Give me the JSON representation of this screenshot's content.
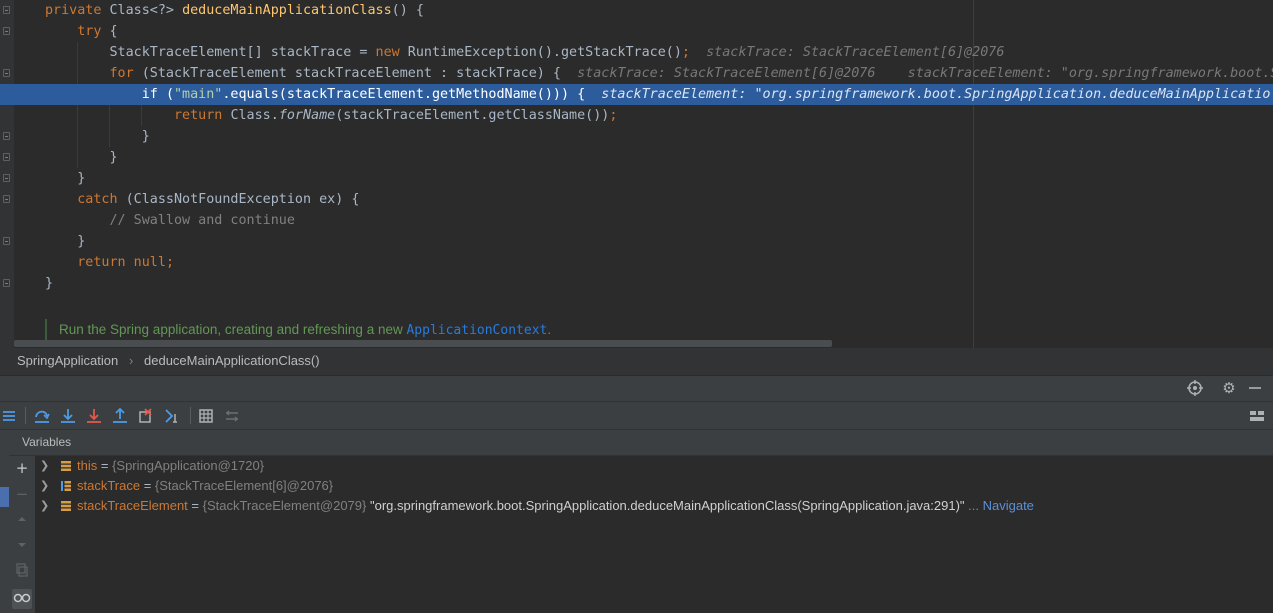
{
  "editor": {
    "lines": [
      [
        {
          "t": "private ",
          "c": "kw"
        },
        {
          "t": "Class<?> ",
          "c": ""
        },
        {
          "t": "deduceMainApplicationClass",
          "c": "fn"
        },
        {
          "t": "() {",
          "c": ""
        }
      ],
      [
        {
          "t": "    try ",
          "c": "kw"
        },
        {
          "t": "{",
          "c": ""
        }
      ],
      [
        {
          "t": "        StackTraceElement[] stackTrace = ",
          "c": ""
        },
        {
          "t": "new ",
          "c": "kw"
        },
        {
          "t": "RuntimeException().getStackTrace()",
          "c": ""
        },
        {
          "t": ";",
          "c": "kw"
        },
        {
          "t": "  stackTrace: StackTraceElement[6]@2076",
          "c": "hint"
        }
      ],
      [
        {
          "t": "        for ",
          "c": "kw"
        },
        {
          "t": "(StackTraceElement stackTraceElement : stackTrace) {",
          "c": ""
        },
        {
          "t": "  stackTrace: StackTraceElement[6]@2076    stackTraceElement: \"org.springframework.boot.S",
          "c": "hint"
        }
      ],
      [
        {
          "t": "            if ",
          "c": ""
        },
        {
          "t": "(",
          "c": ""
        },
        {
          "t": "\"main\"",
          "c": "str"
        },
        {
          "t": ".equals(stackTraceElement.getMethodName())) {",
          "c": ""
        },
        {
          "t": "  stackTraceElement: \"org.springframework.boot.SpringApplication.deduceMainApplicatio",
          "c": "hint"
        }
      ],
      [
        {
          "t": "                return ",
          "c": "kw"
        },
        {
          "t": "Class.",
          "c": ""
        },
        {
          "t": "forName",
          "c": "it"
        },
        {
          "t": "(stackTraceElement.getClassName())",
          "c": ""
        },
        {
          "t": ";",
          "c": "kw"
        }
      ],
      [
        {
          "t": "            }",
          "c": ""
        }
      ],
      [
        {
          "t": "        }",
          "c": ""
        }
      ],
      [
        {
          "t": "    }",
          "c": ""
        }
      ],
      [
        {
          "t": "    catch ",
          "c": "kw"
        },
        {
          "t": "(ClassNotFoundException ex) {",
          "c": ""
        }
      ],
      [
        {
          "t": "        // Swallow and continue",
          "c": "cmt"
        }
      ],
      [
        {
          "t": "    }",
          "c": ""
        }
      ],
      [
        {
          "t": "    return null",
          "c": "kw"
        },
        {
          "t": ";",
          "c": "kw"
        }
      ],
      [
        {
          "t": "}",
          "c": ""
        }
      ]
    ],
    "exec_line_index": 4,
    "doc_comment": {
      "text": "Run the Spring application, creating and refreshing a new ",
      "link": "ApplicationContext",
      "suffix": "."
    }
  },
  "breadcrumb": {
    "class_name": "SpringApplication",
    "separator": "›",
    "method_name": "deduceMainApplicationClass()"
  },
  "debug_header": {
    "icons": [
      "crosshair-icon",
      "gear-icon",
      "minimize-icon"
    ]
  },
  "debug_toolbar": {
    "icons": [
      "show-execution-point-icon",
      "step-over-icon",
      "step-into-icon",
      "force-step-into-icon",
      "step-out-icon",
      "drop-frame-icon",
      "run-to-cursor-icon",
      "evaluate-expression-icon",
      "trace-current-stream-icon",
      "layout-icon"
    ]
  },
  "variables": {
    "title": "Variables",
    "side_icons": [
      "plus-icon",
      "minus-icon",
      "up-arrow-icon",
      "down-arrow-icon",
      "copy-icon",
      "watches-icon"
    ],
    "rows": [
      {
        "name": "this",
        "eq": " = ",
        "type": "{SpringApplication@1720}",
        "value": "",
        "nav": ""
      },
      {
        "name": "stackTrace",
        "eq": " = ",
        "type": "{StackTraceElement[6]@2076}",
        "value": "",
        "nav": ""
      },
      {
        "name": "stackTraceElement",
        "eq": " = ",
        "type": "{StackTraceElement@2079} ",
        "value": "\"org.springframework.boot.SpringApplication.deduceMainApplicationClass(SpringApplication.java:291)\"",
        "nav": " ... Navigate"
      }
    ]
  },
  "colors": {
    "editor_bg": "#2b2b2b",
    "exec_line": "#2d5c9d",
    "keyword": "#cc7832",
    "method": "#ffc66d",
    "string": "#6a8759",
    "link": "#287bde"
  }
}
